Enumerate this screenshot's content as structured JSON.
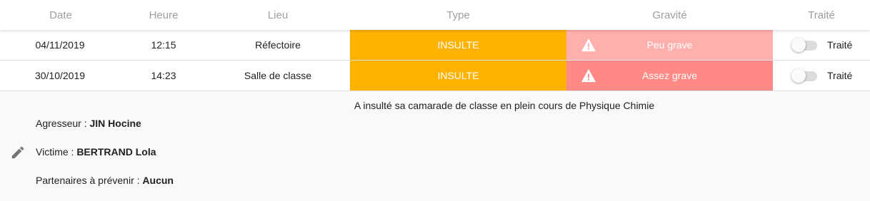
{
  "header": {
    "date": "Date",
    "heure": "Heure",
    "lieu": "Lieu",
    "type": "Type",
    "gravite": "Gravité",
    "traite": "Traité"
  },
  "rows": [
    {
      "date": "04/11/2019",
      "heure": "12:15",
      "lieu": "Réfectoire",
      "type": "INSULTE",
      "gravite": "Peu grave",
      "traite_label": "Traité",
      "traite": false
    },
    {
      "date": "30/10/2019",
      "heure": "14:23",
      "lieu": "Salle de classe",
      "type": "INSULTE",
      "gravite": "Assez grave",
      "traite_label": "Traité",
      "traite": false
    }
  ],
  "details": {
    "description": "A insulté sa camarade de classe en plein cours de Physique Chimie",
    "agresseur_label": "Agresseur : ",
    "agresseur": "JIN Hocine",
    "victime_label": "Victime : ",
    "victime": "BERTRAND Lola",
    "partenaires_label": "Partenaires à prévenir : ",
    "partenaires": "Aucun"
  },
  "icons": {
    "warning": "warning-icon",
    "edit": "pencil-icon"
  },
  "colors": {
    "type_insulte": "#ffb300",
    "gravite_peu": "#ffb0ac",
    "gravite_assez": "#ff8a85",
    "header_text": "#9e9e9e"
  }
}
